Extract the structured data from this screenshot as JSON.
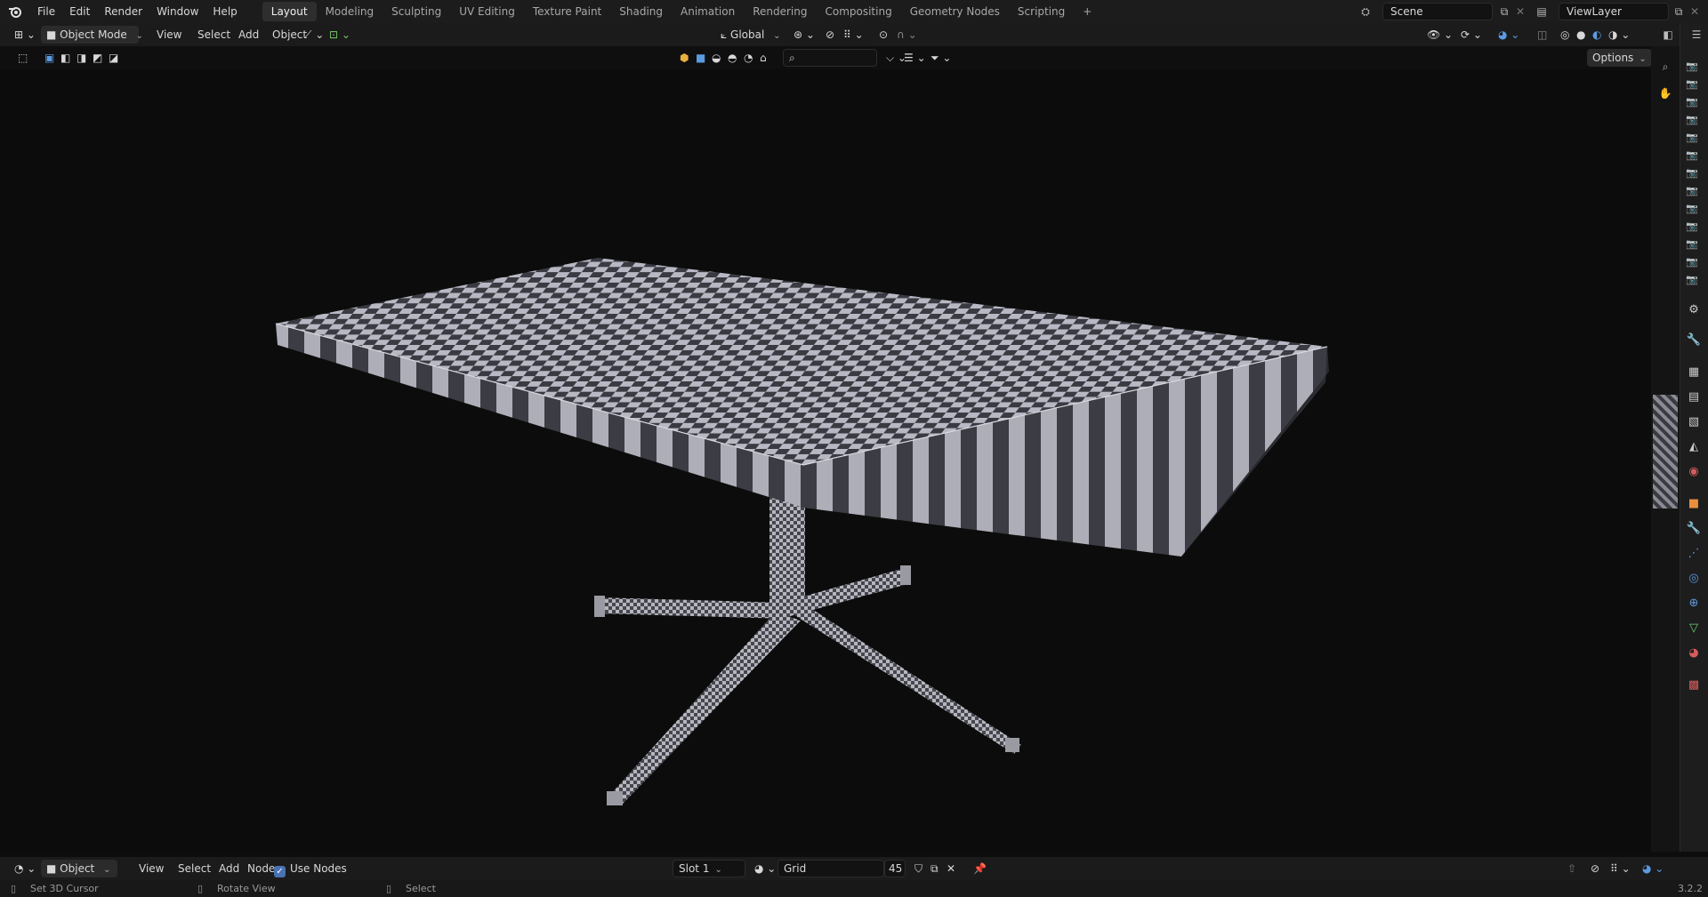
{
  "menu": [
    "File",
    "Edit",
    "Render",
    "Window",
    "Help"
  ],
  "workspaces": [
    "Layout",
    "Modeling",
    "Sculpting",
    "UV Editing",
    "Texture Paint",
    "Shading",
    "Animation",
    "Rendering",
    "Compositing",
    "Geometry Nodes",
    "Scripting"
  ],
  "add_workspace": "+",
  "active_workspace": "Layout",
  "scene_name": "Scene",
  "view_layer": "ViewLayer",
  "header": {
    "mode": "Object Mode",
    "view": "View",
    "select": "Select",
    "add": "Add",
    "object": "Object",
    "transform_orientation": "Global",
    "options": "Options"
  },
  "footer": {
    "editor_type": "Object",
    "view": "View",
    "select": "Select",
    "add": "Add",
    "node": "Node",
    "use_nodes": "Use Nodes",
    "slot": "Slot 1",
    "material": "Grid",
    "users": "45"
  },
  "status": {
    "left": "Set 3D Cursor",
    "middle": "Rotate View",
    "right": "Select",
    "version": "3.2.2"
  },
  "colors": {
    "accent_blue": "#4772b3",
    "checker_light": "#b8b8c4",
    "checker_dark": "#3a3a42"
  }
}
